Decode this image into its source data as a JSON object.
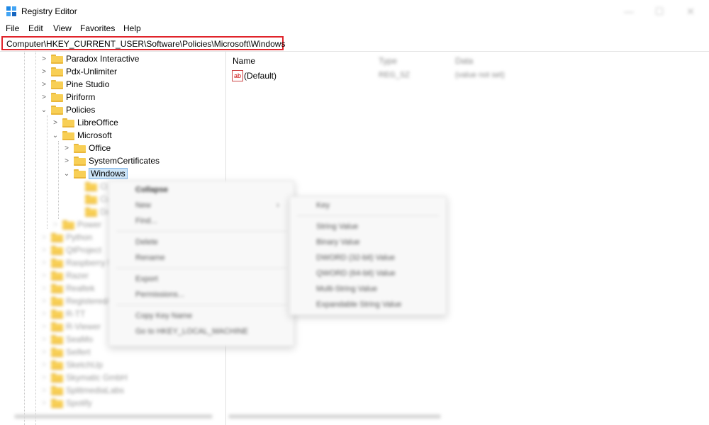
{
  "window": {
    "title": "Registry Editor",
    "controls": [
      "—",
      "☐",
      "✕"
    ]
  },
  "menubar": {
    "items": [
      "File",
      "Edit",
      "View",
      "Favorites",
      "Help"
    ]
  },
  "address": {
    "path": "Computer\\HKEY_CURRENT_USER\\Software\\Policies\\Microsoft\\Windows"
  },
  "tree": {
    "clear": [
      {
        "label": "Paradox Interactive",
        "expanded": false
      },
      {
        "label": "Pdx-Unlimiter",
        "expanded": false
      },
      {
        "label": "Pine Studio",
        "expanded": false
      },
      {
        "label": "Piriform",
        "expanded": false
      },
      {
        "label": "Policies",
        "expanded": true
      },
      {
        "label": "LibreOffice",
        "expanded": false
      },
      {
        "label": "Microsoft",
        "expanded": true
      },
      {
        "label": "Office",
        "expanded": false
      },
      {
        "label": "SystemCertificates",
        "expanded": false
      },
      {
        "label": "Windows",
        "expanded": true,
        "selected": true
      }
    ],
    "blurred_children": [
      "Cl",
      "Cu",
      "Da"
    ],
    "blurred": [
      "Power",
      "Python",
      "QtProject",
      "Raspberry P",
      "Razer",
      "Realtek",
      "RegisteredA",
      "R-TT",
      "R-Viewer",
      "SeaMo",
      "Seifert",
      "SketchUp",
      "Skymatic GmbH",
      "SplitmediaLabs",
      "Spotify"
    ]
  },
  "list": {
    "columns": {
      "name": "Name",
      "type": "Type",
      "data": "Data"
    },
    "rows": [
      {
        "name": "(Default)",
        "type": "REG_SZ",
        "data": "(value not set)",
        "icon": "ab"
      }
    ]
  },
  "context_menu": {
    "items": [
      "Collapse",
      "New",
      "Find...",
      "Delete",
      "Rename",
      "Export",
      "Permissions...",
      "Copy Key Name",
      "Go to HKEY_LOCAL_MACHINE"
    ],
    "submenu_arrow": "›"
  },
  "new_submenu": {
    "items": [
      "Key",
      "String Value",
      "Binary Value",
      "DWORD (32-bit) Value",
      "QWORD (64-bit) Value",
      "Multi-String Value",
      "Expandable String Value"
    ]
  }
}
